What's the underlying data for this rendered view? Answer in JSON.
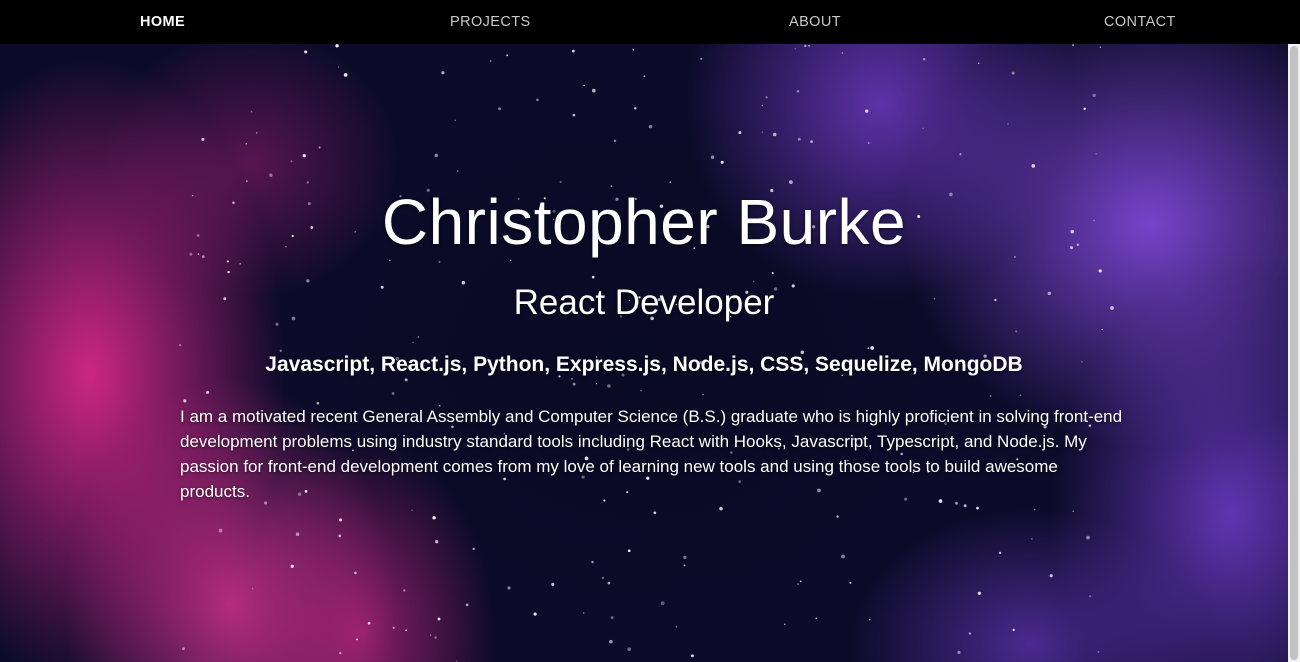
{
  "nav": {
    "items": [
      {
        "label": "HOME",
        "active": true
      },
      {
        "label": "PROJECTS",
        "active": false
      },
      {
        "label": "ABOUT",
        "active": false
      },
      {
        "label": "CONTACT",
        "active": false
      }
    ]
  },
  "hero": {
    "name": "Christopher Burke",
    "role": "React Developer",
    "skills": "Javascript, React.js, Python, Express.js, Node.js, CSS, Sequelize, MongoDB",
    "bio": "I am a motivated recent General Assembly and Computer Science (B.S.) graduate who is highly proficient in solving front-end development problems using industry standard tools including React with Hooks, Javascript, Typescript, and Node.js. My passion for front-end development comes from my love of learning new tools and using those tools to build awesome products."
  },
  "colors": {
    "navbar": "#000000",
    "nav_text": "#c9c9c9",
    "nav_active": "#ffffff",
    "nebula_pink": "#d62887",
    "nebula_purple": "#7d46d2",
    "space_dark": "#0c0b28",
    "text": "#ffffff"
  }
}
